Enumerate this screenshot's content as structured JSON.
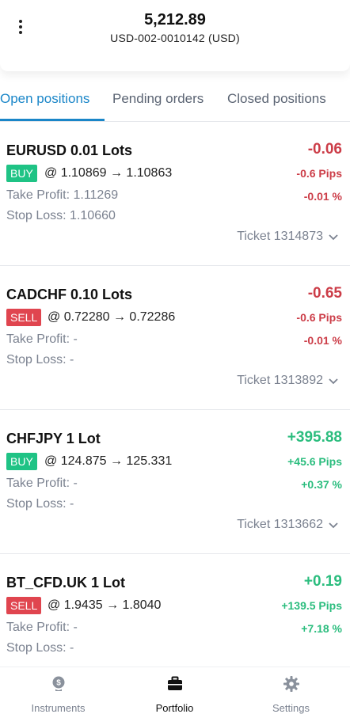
{
  "header": {
    "balance": "5,212.89",
    "account": "USD-002-0010142 (USD)"
  },
  "tabs": [
    {
      "label": "Open positions",
      "active": true
    },
    {
      "label": "Pending orders",
      "active": false
    },
    {
      "label": "Closed positions",
      "active": false
    }
  ],
  "positions": [
    {
      "symbol": "EURUSD  0.01 Lots",
      "side": "BUY",
      "prices": "@ 1.10869 → 1.10863",
      "take_profit": "Take Profit: 1.11269",
      "stop_loss": "Stop Loss: 1.10660",
      "profit": "-0.06",
      "pips": "-0.6 Pips",
      "percent": "-0.01 %",
      "ticket": "Ticket 1314873"
    },
    {
      "symbol": "CADCHF  0.10 Lots",
      "side": "SELL",
      "prices": "@ 0.72280 → 0.72286",
      "take_profit": "Take Profit: -",
      "stop_loss": "Stop Loss: -",
      "profit": "-0.65",
      "pips": "-0.6 Pips",
      "percent": "-0.01 %",
      "ticket": "Ticket 1313892"
    },
    {
      "symbol": "CHFJPY  1 Lot",
      "side": "BUY",
      "prices": "@ 124.875 → 125.331",
      "take_profit": "Take Profit: -",
      "stop_loss": "Stop Loss: -",
      "profit": "+395.88",
      "pips": "+45.6 Pips",
      "percent": "+0.37 %",
      "ticket": "Ticket 1313662"
    },
    {
      "symbol": "BT_CFD.UK  1 Lot",
      "side": "SELL",
      "prices": "@ 1.9435 → 1.8040",
      "take_profit": "Take Profit: -",
      "stop_loss": "Stop Loss: -",
      "profit": "+0.19",
      "pips": "+139.5 Pips",
      "percent": "+7.18 %",
      "ticket": ""
    }
  ],
  "bottom_nav": [
    {
      "label": "Instruments",
      "icon": "dollar-bag-icon",
      "active": false
    },
    {
      "label": "Portfolio",
      "icon": "briefcase-icon",
      "active": true
    },
    {
      "label": "Settings",
      "icon": "gear-icon",
      "active": false
    }
  ],
  "colors": {
    "accent": "#1a86c8",
    "buy": "#1fc385",
    "sell": "#e0454f",
    "negative": "#cc3d48",
    "positive": "#2bbd7e"
  }
}
